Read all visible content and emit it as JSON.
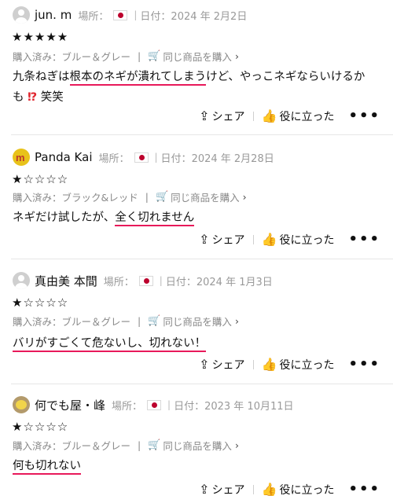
{
  "labels": {
    "location": "場所：",
    "date": "日付：",
    "same_product": "同じ商品を購入",
    "share": "シェア",
    "helpful": "役に立った",
    "more": "•••"
  },
  "reviews": [
    {
      "user": "jun. m",
      "date": "2024 年 2月2日",
      "stars": "★★★★★",
      "purchase": "購入済み：ブルー＆グレー",
      "text_before": "九条ねぎは",
      "text_highlight": "根本のネギが潰れてしまう",
      "text_after": "けど、やっこネギならいけるか",
      "text_line2": "も",
      "text_mark": "⁉",
      "text_line2_after": "笑笑"
    },
    {
      "user": "Panda Kai",
      "date": "2024 年 2月28日",
      "stars": "★☆☆☆☆",
      "purchase": "購入済み：ブラック&レッド",
      "text_before": "ネギだけ試したが、",
      "text_highlight": "全く切れません"
    },
    {
      "user": "真由美 本間",
      "date": "2024 年 1月3日",
      "stars": "★☆☆☆☆",
      "purchase": "購入済み：ブルー＆グレー",
      "text_highlight": "バリがすごくて危ないし、切れない！"
    },
    {
      "user": "何でも屋・峰",
      "date": "2023 年 10月11日",
      "stars": "★☆☆☆☆",
      "purchase": "購入済み：ブルー＆グレー",
      "text_highlight": "何も切れない"
    }
  ]
}
